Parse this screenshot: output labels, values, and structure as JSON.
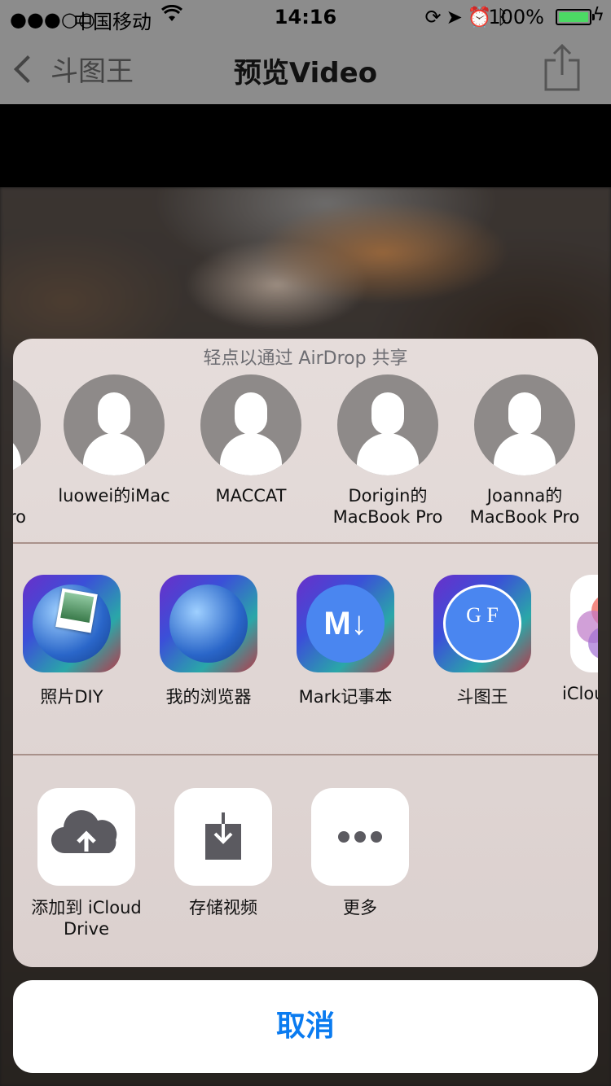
{
  "status_bar": {
    "signal": "●●●○○",
    "carrier": "中国移动",
    "time": "14:16",
    "battery_percent": "100%",
    "battery_level": 1.0,
    "battery_color": "#4cd964"
  },
  "nav": {
    "back_label": "斗图王",
    "title": "预览Video"
  },
  "share_sheet": {
    "airdrop_title": "轻点以通过 AirDrop 共享",
    "contacts": [
      {
        "name": "Pro"
      },
      {
        "name": "luowei的iMac"
      },
      {
        "name": "MACCAT"
      },
      {
        "name": "Dorigin的\nMacBook Pro"
      },
      {
        "name": "Joanna的\nMacBook Pro"
      }
    ],
    "apps": [
      {
        "label": "照片DIY",
        "icon": "photo-diy-icon"
      },
      {
        "label": "我的浏览器",
        "icon": "browser-icon"
      },
      {
        "label": "Mark记事本",
        "icon": "markdown-icon",
        "glyph": "M↓"
      },
      {
        "label": "斗图王",
        "icon": "doutuwang-icon",
        "glyph": "G F"
      },
      {
        "label": "iClou",
        "icon": "photos-icon"
      }
    ],
    "actions": [
      {
        "label": "添加到 iCloud\nDrive",
        "icon": "icloud-upload-icon"
      },
      {
        "label": "存储视频",
        "icon": "save-video-icon"
      },
      {
        "label": "更多",
        "icon": "more-icon"
      }
    ]
  },
  "cancel_label": "取消",
  "colors": {
    "accent": "#0a7bf0",
    "bar_gray": "#8c8c8c"
  }
}
